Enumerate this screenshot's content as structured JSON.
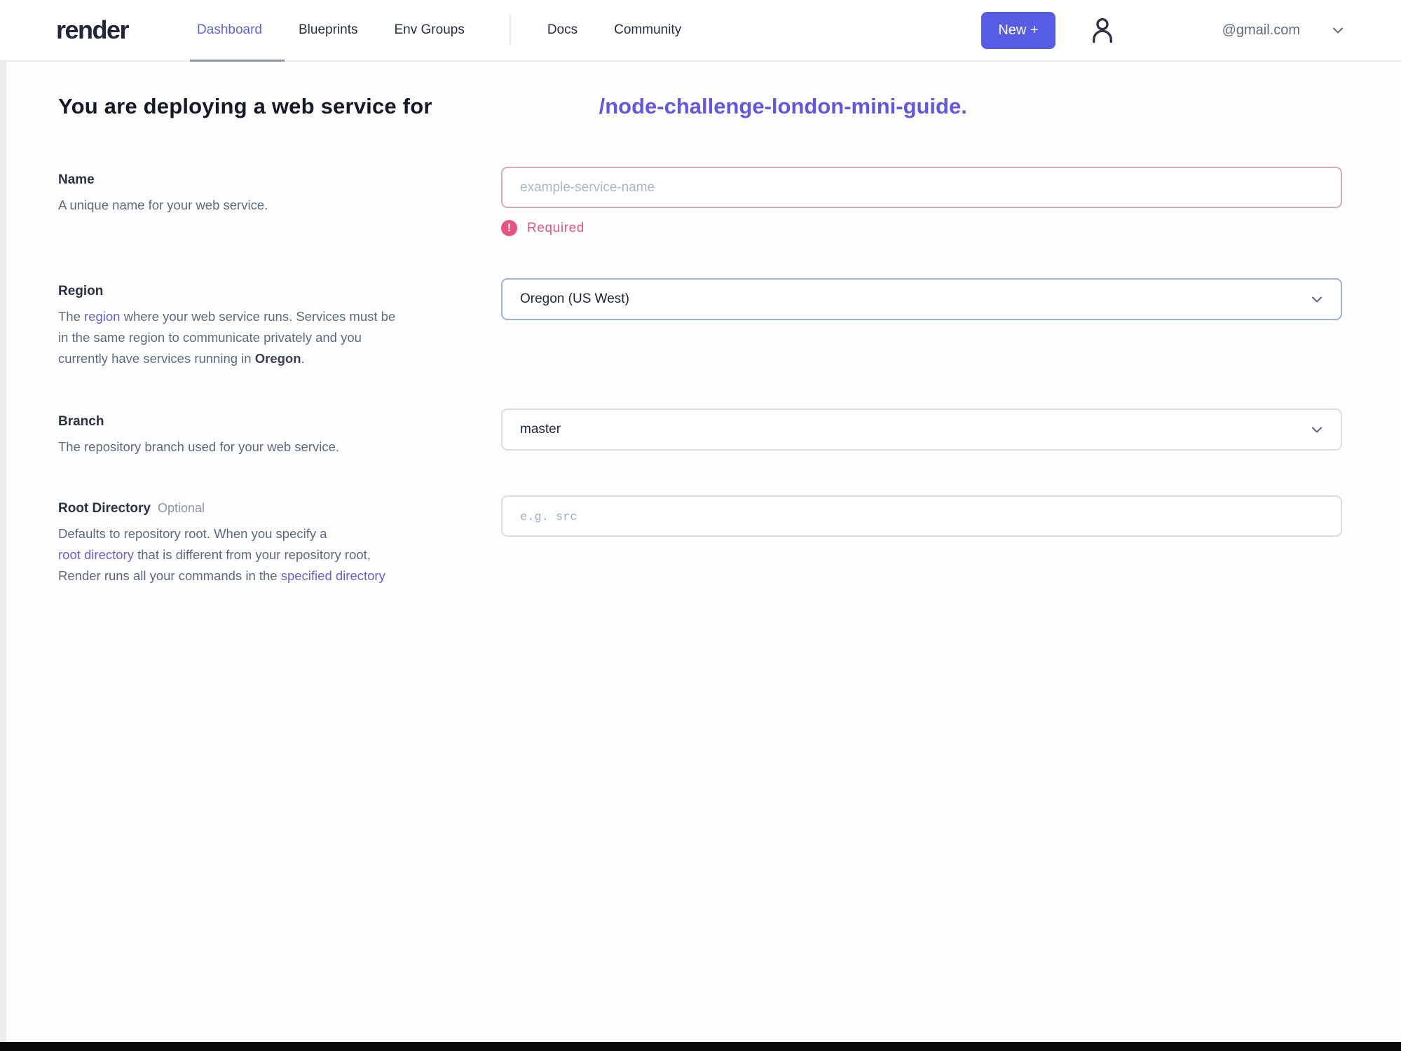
{
  "nav": {
    "logo": "render",
    "items": [
      {
        "label": "Dashboard",
        "active": true
      },
      {
        "label": "Blueprints",
        "active": false
      },
      {
        "label": "Env Groups",
        "active": false
      },
      {
        "label": "Docs",
        "active": false
      },
      {
        "label": "Community",
        "active": false
      }
    ],
    "new_button_label": "New +",
    "account_email": "@gmail.com"
  },
  "icons": {
    "user": "user-outline-icon",
    "chevron_down": "chevron-down-icon",
    "error_glyph": "!"
  },
  "colors": {
    "accent_indigo": "#575ce4",
    "repo_purple": "#6257e5",
    "link_purple": "#675fd9",
    "error_pink": "#e8537f",
    "error_border": "#dba7ba",
    "focus_border": "#9cb0e9"
  },
  "heading": {
    "prefix": "You are deploying a web service for",
    "repo_path": "/node-challenge-london-mini-guide."
  },
  "form": {
    "name": {
      "label": "Name",
      "description": "A unique name for your web service.",
      "placeholder": "example-service-name",
      "error": "Required"
    },
    "region": {
      "label": "Region",
      "line1_pre": "The ",
      "line1_link": "region",
      "line1_post": " where your web service runs. Services must be",
      "line2": "in the same region to communicate privately and you",
      "line3_pre": "currently have services running in ",
      "line3_bold": "Oregon",
      "line3_post": ".",
      "value": "Oregon (US West)"
    },
    "branch": {
      "label": "Branch",
      "description": "The repository branch used for your web service.",
      "value": "master"
    },
    "root_directory": {
      "label": "Root Directory",
      "optional_tag": "Optional",
      "line1": "Defaults to repository root. When you specify a",
      "line2_link": "root directory",
      "line2_post": " that is different from your repository root,",
      "line3_pre": "Render runs all your commands in the ",
      "line3_link": "specified directory",
      "placeholder": "e.g. src"
    }
  }
}
